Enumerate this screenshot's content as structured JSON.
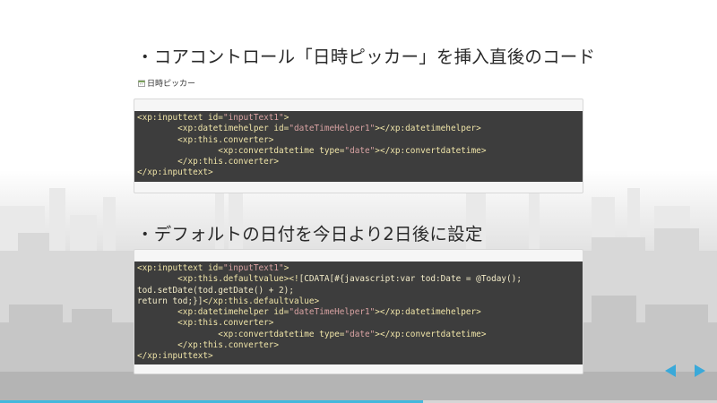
{
  "slide": {
    "heading1": "・コアコントロール「日時ピッカー」を挿入直後のコード",
    "caption": "日時ピッカー",
    "caption_icon": "calendar-icon",
    "heading2": "・デフォルトの日付を今日より2日後に設定"
  },
  "code1": [
    [
      {
        "t": "tag",
        "s": "<xp:inputtext id="
      },
      {
        "t": "val",
        "s": "\"inputText1\""
      },
      {
        "t": "tag",
        "s": ">"
      }
    ],
    [
      {
        "t": "tag",
        "s": "        <xp:datetimehelper id="
      },
      {
        "t": "val",
        "s": "\"dateTimeHelper1\""
      },
      {
        "t": "tag",
        "s": "></xp:datetimehelper>"
      }
    ],
    [
      {
        "t": "tag",
        "s": "        <xp:this.converter>"
      }
    ],
    [
      {
        "t": "tag",
        "s": "                <xp:convertdatetime type="
      },
      {
        "t": "val",
        "s": "\"date\""
      },
      {
        "t": "tag",
        "s": "></xp:convertdatetime>"
      }
    ],
    [
      {
        "t": "tag",
        "s": "        </xp:this.converter>"
      }
    ],
    [
      {
        "t": "tag",
        "s": "</xp:inputtext>"
      }
    ]
  ],
  "code2": [
    [
      {
        "t": "tag",
        "s": "<xp:inputtext id="
      },
      {
        "t": "val",
        "s": "\"inputText1\""
      },
      {
        "t": "tag",
        "s": ">"
      }
    ],
    [
      {
        "t": "tag",
        "s": "        <xp:this.defaultvalue><!"
      },
      {
        "t": "cd",
        "s": "[CDATA[#{javascript:var tod:Date = @Today();"
      }
    ],
    [
      {
        "t": "cd",
        "s": "tod.setDate(tod.getDate() + 2);"
      }
    ],
    [
      {
        "t": "cd",
        "s": "return tod;}]"
      },
      {
        "t": "tag",
        "s": "</xp:this.defaultvalue>"
      }
    ],
    [
      {
        "t": "tag",
        "s": "        <xp:datetimehelper id="
      },
      {
        "t": "val",
        "s": "\"dateTimeHelper1\""
      },
      {
        "t": "tag",
        "s": "></xp:datetimehelper>"
      }
    ],
    [
      {
        "t": "tag",
        "s": "        <xp:this.converter>"
      }
    ],
    [
      {
        "t": "tag",
        "s": "                <xp:convertdatetime type="
      },
      {
        "t": "val",
        "s": "\"date\""
      },
      {
        "t": "tag",
        "s": "></xp:convertdatetime>"
      }
    ],
    [
      {
        "t": "tag",
        "s": "        </xp:this.converter>"
      }
    ],
    [
      {
        "t": "tag",
        "s": "</xp:inputtext>"
      }
    ]
  ],
  "nav": {
    "prev_icon": "arrow-left-icon",
    "next_icon": "arrow-right-icon",
    "color": "#3aa9d9"
  },
  "progress": {
    "fraction": 0.59,
    "color": "#42b8dd"
  }
}
